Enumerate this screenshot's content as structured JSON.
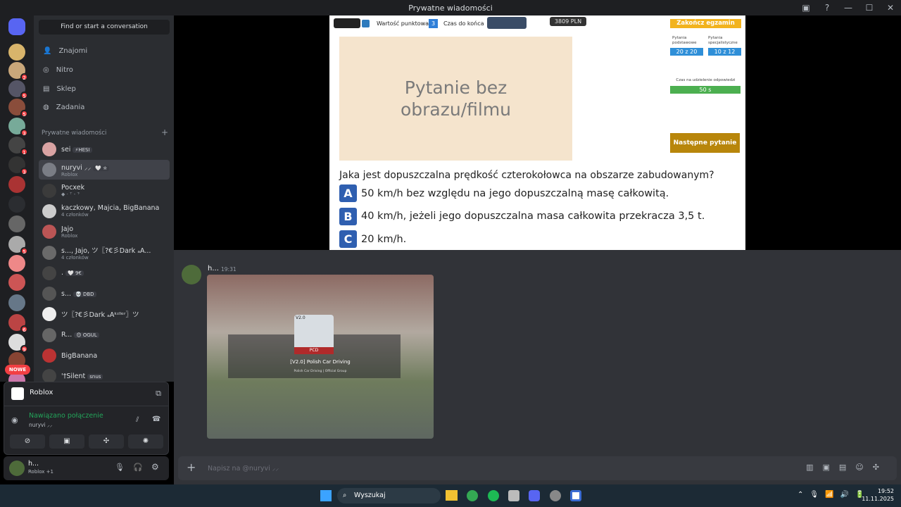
{
  "window": {
    "title": "Prywatne wiadomości"
  },
  "sidebar": {
    "search": "Find or start a conversation",
    "nav": [
      {
        "label": "Znajomi",
        "icon": "friends-icon"
      },
      {
        "label": "Nitro",
        "icon": "nitro-icon"
      },
      {
        "label": "Sklep",
        "icon": "shop-icon"
      },
      {
        "label": "Zadania",
        "icon": "quests-icon"
      }
    ],
    "dm_header": "Prywatne wiadomości",
    "dm_add": "+",
    "dms": [
      {
        "name": "sei",
        "tag": "⚡HESI",
        "sub": ""
      },
      {
        "name": "nuryvi ⸝⸝",
        "tag": "🤍 ✮",
        "sub": "Roblox"
      },
      {
        "name": "Pocxek",
        "tag": "",
        "sub": "◆ · ⸆ - ⸇"
      },
      {
        "name": "kaczkowy, Majcia, BigBanana",
        "tag": "",
        "sub": "4 członków"
      },
      {
        "name": "Jajo",
        "tag": "",
        "sub": "Roblox"
      },
      {
        "name": "s..., Jajo, ツ〖?€彡Dark ₐA...",
        "tag": "",
        "sub": "4 członków"
      },
      {
        "name": ".",
        "tag": "🤍 9€",
        "sub": ""
      },
      {
        "name": "s...",
        "tag": "💀 DBD",
        "sub": ""
      },
      {
        "name": "ツ〖?€彡Dark ₐAᵏᶦˡˡᵉʳ〗ツ",
        "tag": "",
        "sub": ""
      },
      {
        "name": "R...",
        "tag": "😊 OGUL",
        "sub": ""
      },
      {
        "name": "BigBanana",
        "tag": "",
        "sub": ""
      },
      {
        "name": "ꞌ†Silent",
        "tag": "snus",
        "sub": ""
      }
    ],
    "nowe": "NOWE",
    "guild_badges": [
      "",
      "",
      "2",
      "5",
      "5",
      "3",
      "1",
      "3",
      "",
      "",
      "",
      "5",
      "",
      "",
      "",
      "6",
      "9",
      "",
      ""
    ]
  },
  "voice_panel": {
    "app": "Roblox",
    "status": "Nawiązano połączenie",
    "user": "nuryvi ⸝⸝"
  },
  "user_bar": {
    "name": "h...",
    "status": "Roblox +1"
  },
  "exam": {
    "points_label": "Wartość punktowa",
    "points_value": "3",
    "time_label": "Czas do końca",
    "money": "3809 PLN",
    "end_button": "Zakończ egzamin",
    "basic_label": "Pytania podstawowe",
    "basic_value": "20 z 20",
    "special_label": "Pytania specjalistyczne",
    "special_value": "10 z 12",
    "answer_time_label": "Czas na udzielenie odpowiedzi",
    "answer_time_value": "50 s",
    "answer_time_fraction": 1.0,
    "next_button": "Następne pytanie",
    "media_text": "Pytanie bez obrazu/filmu",
    "question": "Jaka jest dopuszczalna prędkość czterokołowca na obszarze zabudowanym?",
    "answers": [
      {
        "letter": "A",
        "text": "50 km/h bez względu na jego dopuszczalną masę całkowitą."
      },
      {
        "letter": "B",
        "text": "40 km/h, jeżeli jego dopuszczalna masa całkowita przekracza 3,5 t."
      },
      {
        "letter": "C",
        "text": "20 km/h."
      }
    ]
  },
  "chat": {
    "author": "h...",
    "time": "19:31",
    "embed_tag": "V2.0",
    "embed_pcd": "PCD",
    "embed_title": "[V2.0] Polish Car Driving",
    "embed_sub": "Polish Car Driving | Official Group",
    "composer_placeholder": "Napisz na @nuryvi ⸝⸝"
  },
  "taskbar": {
    "search": "Wyszukaj",
    "time": "19:52",
    "date": "11.11.2025"
  }
}
